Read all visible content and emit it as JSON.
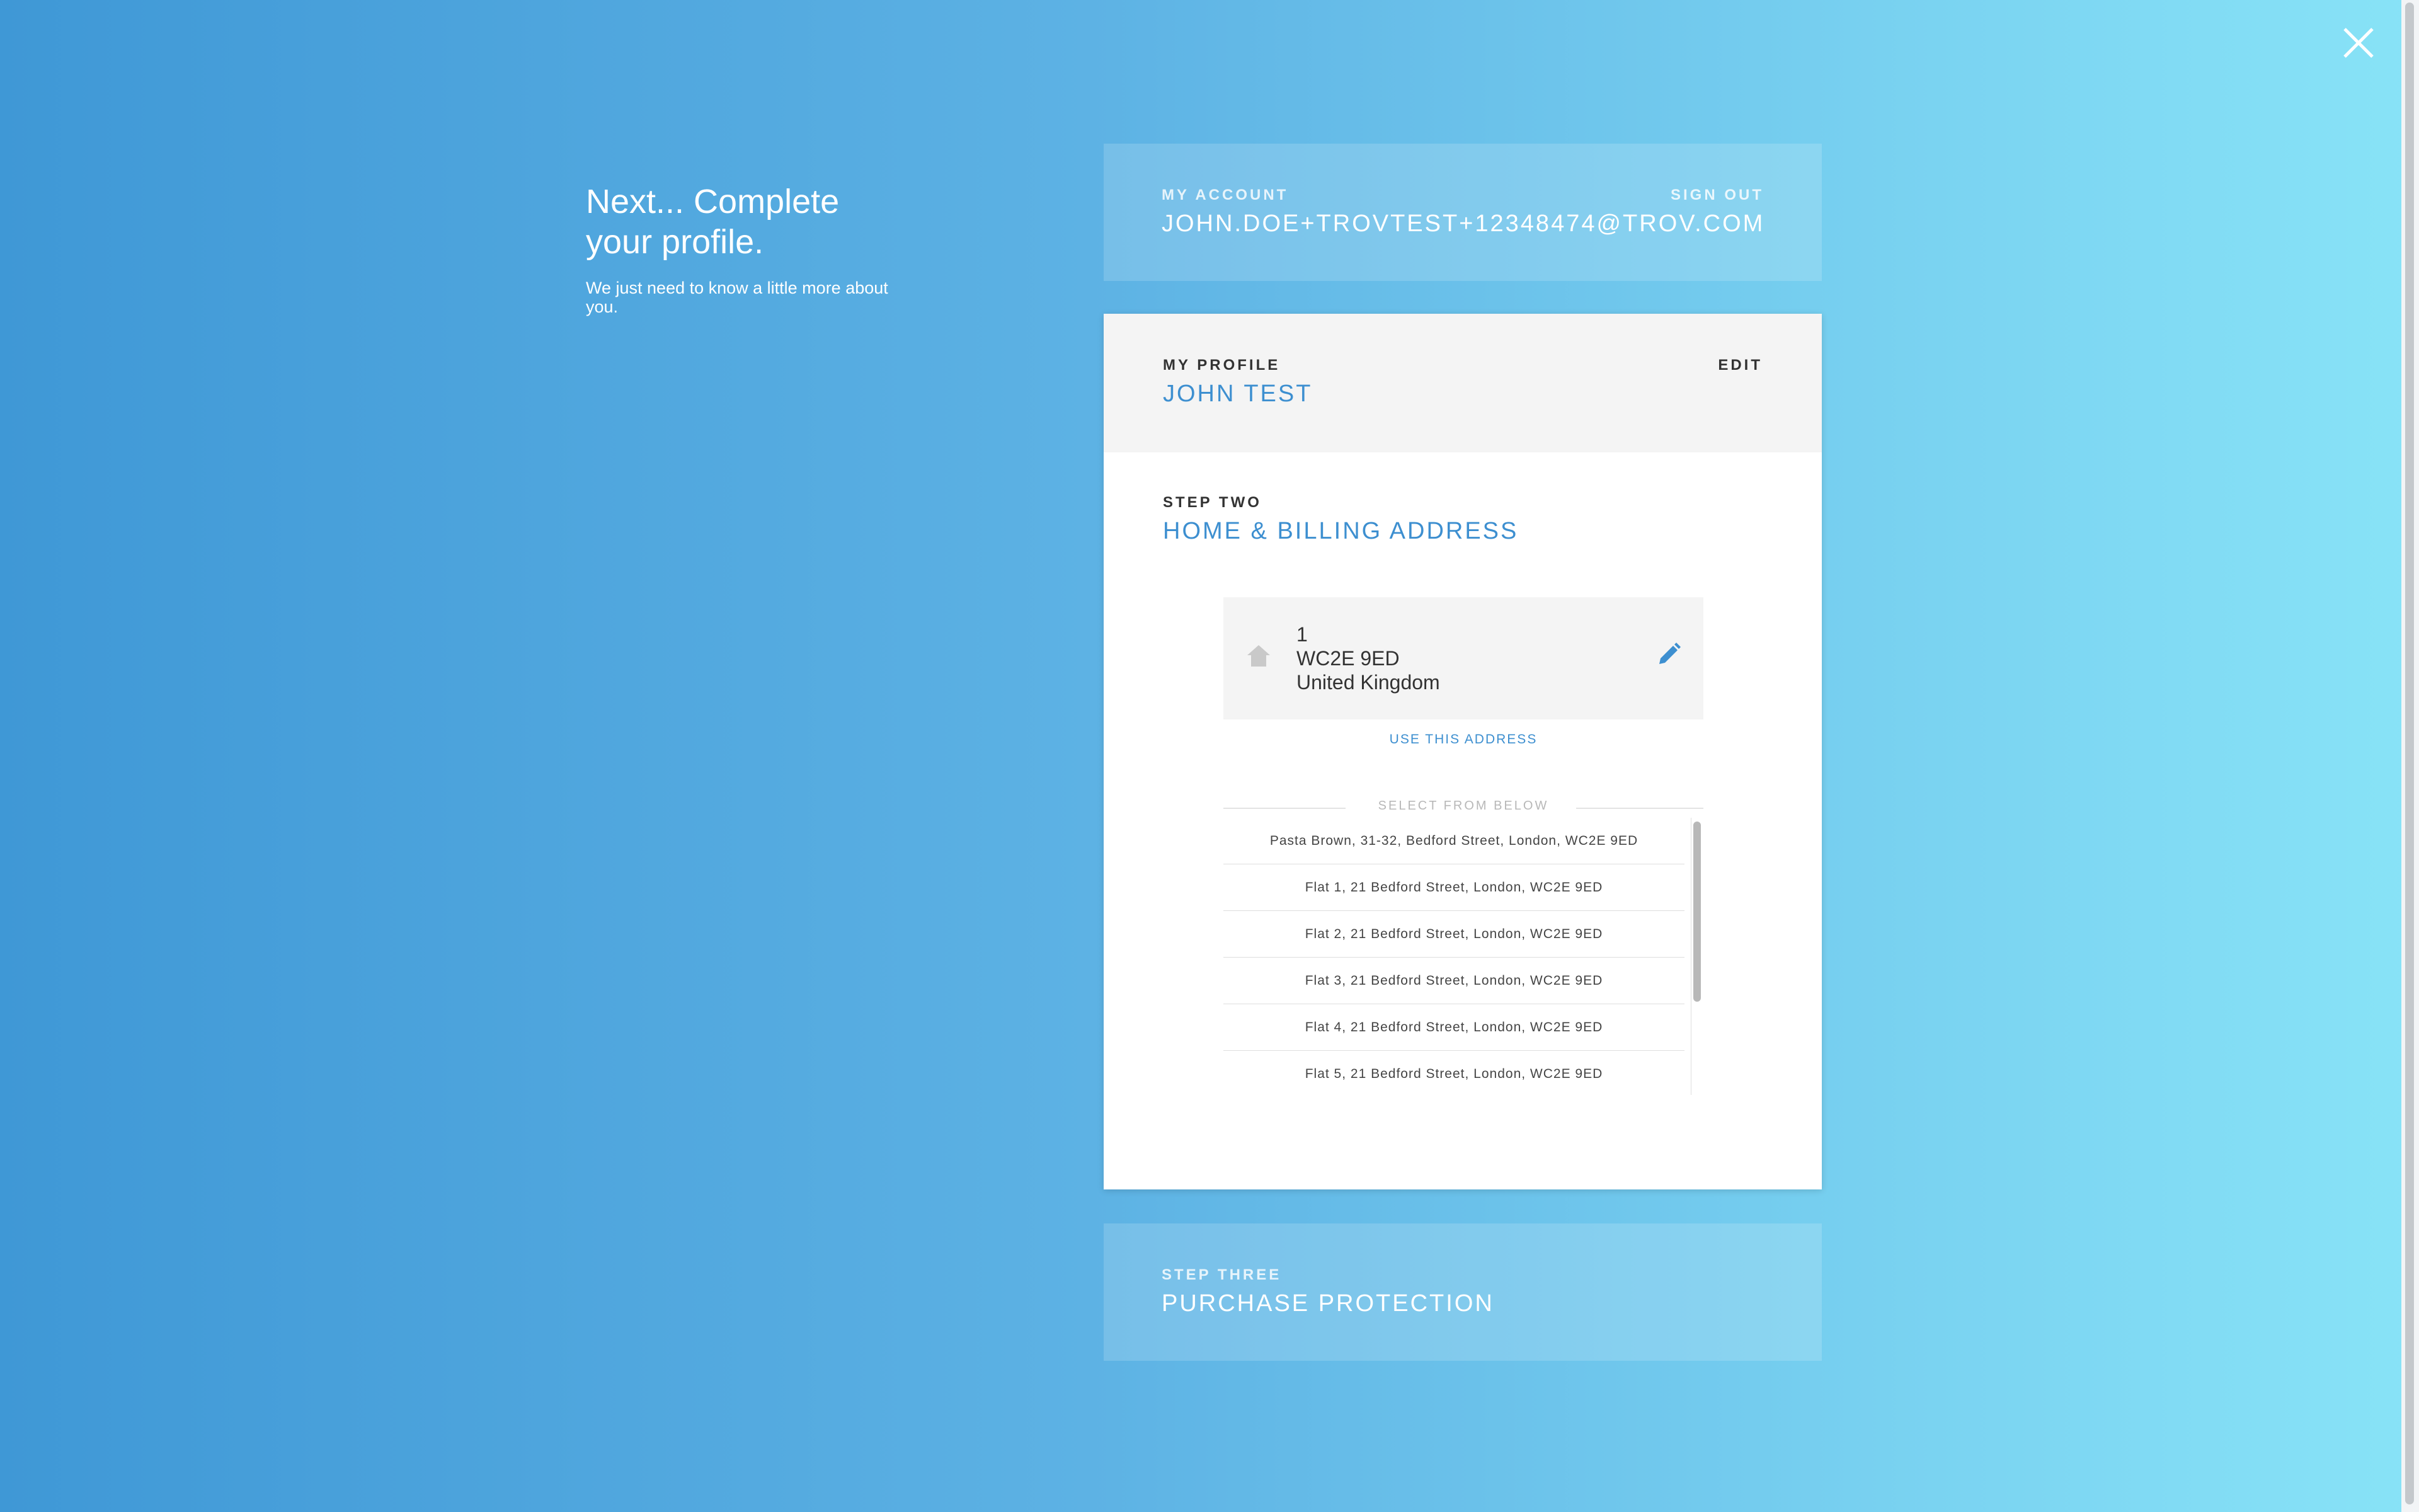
{
  "intro": {
    "title": "Next... Complete your profile.",
    "subtitle": "We just need to know a little more about you."
  },
  "account": {
    "label": "MY ACCOUNT",
    "email": "JOHN.DOE+TROVTEST+12348474@TROV.COM",
    "sign_out": "SIGN OUT"
  },
  "profile": {
    "label": "MY PROFILE",
    "name": "JOHN TEST",
    "edit": "EDIT"
  },
  "step_two": {
    "label": "STEP TWO",
    "title": "HOME & BILLING ADDRESS",
    "address": {
      "line1": "1",
      "line2": "WC2E 9ED",
      "line3": "United Kingdom"
    },
    "use_address": "USE THIS ADDRESS",
    "select_label": "SELECT FROM BELOW",
    "options": [
      "Pasta Brown, 31-32, Bedford Street, London, WC2E 9ED",
      "Flat 1, 21 Bedford Street, London, WC2E 9ED",
      "Flat 2, 21 Bedford Street, London, WC2E 9ED",
      "Flat 3, 21 Bedford Street, London, WC2E 9ED",
      "Flat 4, 21 Bedford Street, London, WC2E 9ED",
      "Flat 5, 21 Bedford Street, London, WC2E 9ED"
    ]
  },
  "step_three": {
    "label": "STEP THREE",
    "title": "PURCHASE PROTECTION"
  },
  "icons": {
    "close": "close-icon",
    "home": "home-icon",
    "edit": "pencil-icon"
  },
  "colors": {
    "accent": "#3d8fd0",
    "bg_left": "#3f98d6",
    "bg_right": "#88e3f7"
  }
}
